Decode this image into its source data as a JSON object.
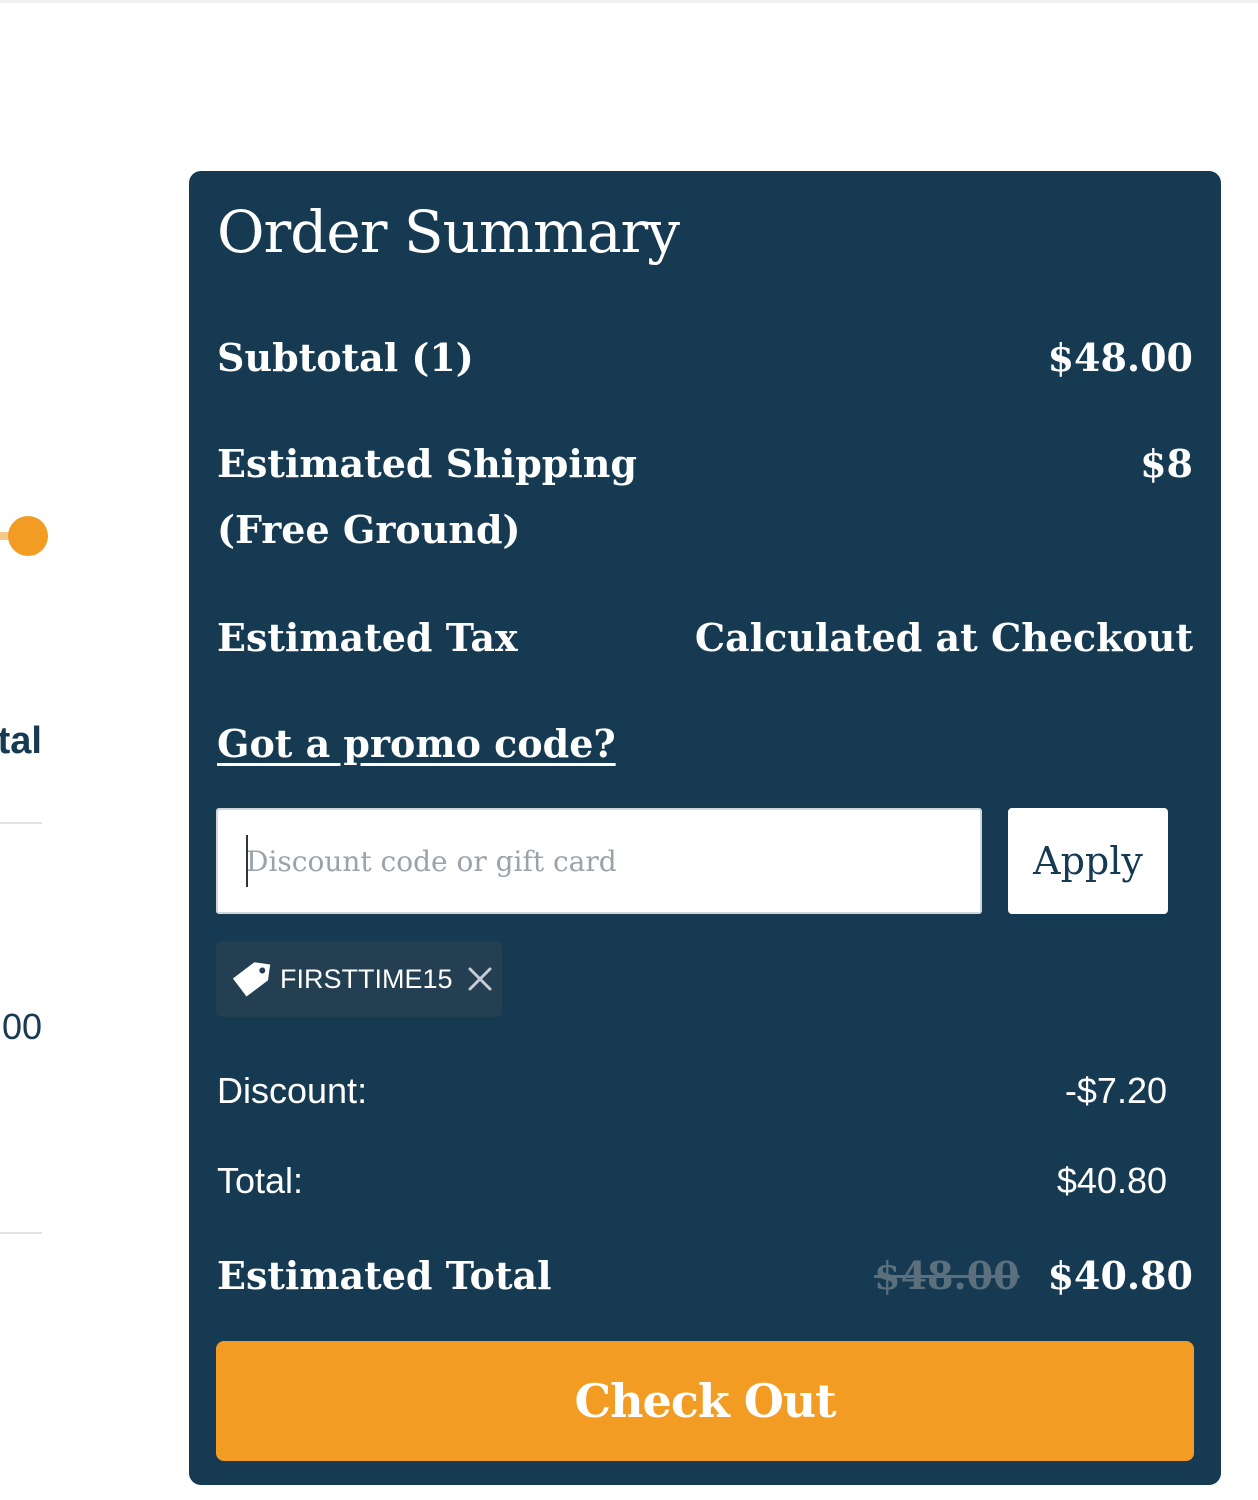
{
  "background": {
    "left_label_fragment": "tal",
    "left_value_fragment": "00"
  },
  "order_summary": {
    "title": "Order Summary",
    "subtotal_label": "Subtotal (1)",
    "subtotal_value": "$48.00",
    "shipping_label_line1": "Estimated Shipping",
    "shipping_label_line2": "(Free Ground)",
    "shipping_value": "$8",
    "tax_label": "Estimated Tax",
    "tax_value": "Calculated at Checkout",
    "promo_link": "Got a promo code?",
    "promo_placeholder": "Discount code or gift card",
    "apply_label": "Apply",
    "applied_code": "FIRSTTIME15",
    "discount_label": "Discount:",
    "discount_value": "-$7.20",
    "total_label": "Total:",
    "total_value": "$40.80",
    "estimated_total_label": "Estimated Total",
    "estimated_total_old": "$48.00",
    "estimated_total_new": "$40.80",
    "checkout_label": "Check Out"
  },
  "icons": {
    "tag": "tag-icon",
    "remove": "close-icon"
  },
  "colors": {
    "panel_bg": "#163a52",
    "accent": "#f29c23",
    "chip_bg": "#243e52",
    "strikethrough": "#5c6f7d"
  }
}
